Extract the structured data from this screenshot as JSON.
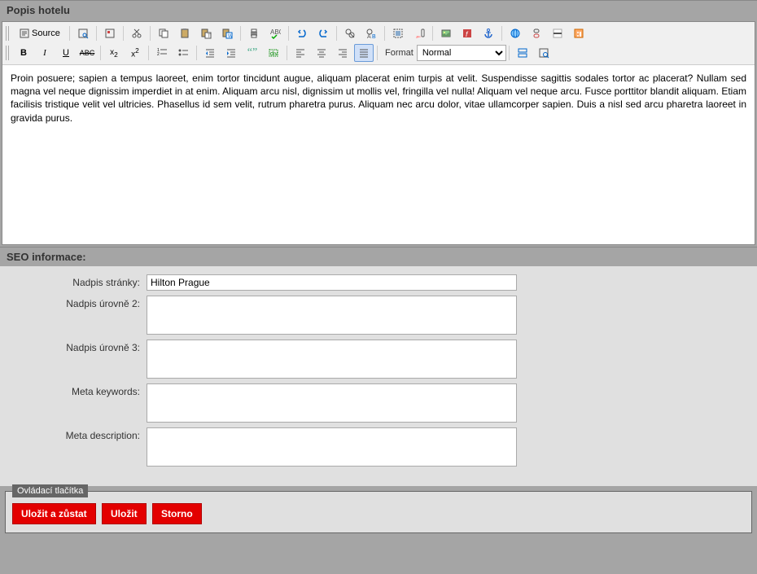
{
  "sections": {
    "hotel_desc": "Popis hotelu",
    "seo": "SEO informace:",
    "controls": "Ovládací tlačítka"
  },
  "toolbar": {
    "source_label": "Source",
    "format_label": "Format",
    "format_value": "Normal"
  },
  "editor": {
    "content": "Proin posuere; sapien a tempus laoreet, enim tortor tincidunt augue, aliquam placerat enim turpis at velit. Suspendisse sagittis sodales tortor ac placerat? Nullam sed magna vel neque dignissim imperdiet in at enim. Aliquam arcu nisl, dignissim ut mollis vel, fringilla vel nulla! Aliquam vel neque arcu. Fusce porttitor blandit aliquam. Etiam facilisis tristique velit vel ultricies. Phasellus id sem velit, rutrum pharetra purus. Aliquam nec arcu dolor, vitae ullamcorper sapien. Duis a nisl sed arcu pharetra laoreet in gravida purus."
  },
  "seo": {
    "page_title_label": "Nadpis stránky:",
    "page_title_value": "Hilton Prague",
    "h2_label": "Nadpis úrovně 2:",
    "h2_value": "",
    "h3_label": "Nadpis úrovně 3:",
    "h3_value": "",
    "keywords_label": "Meta keywords:",
    "keywords_value": "",
    "description_label": "Meta description:",
    "description_value": ""
  },
  "buttons": {
    "save_stay": "Uložit a zůstat",
    "save": "Uložit",
    "cancel": "Storno"
  }
}
